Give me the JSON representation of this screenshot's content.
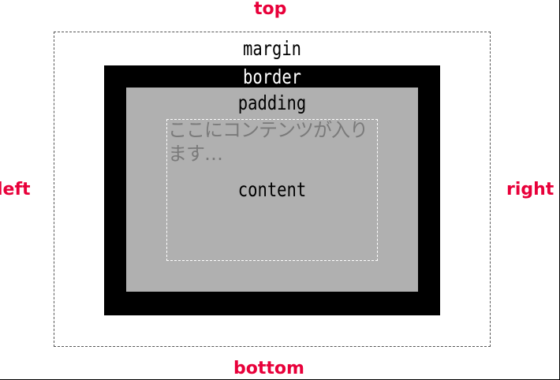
{
  "sides": {
    "top": "top",
    "bottom": "bottom",
    "left": "left",
    "right": "right"
  },
  "boxes": {
    "margin": "margin",
    "border": "border",
    "padding": "padding",
    "content": "content"
  },
  "content_text": "ここにコンテンツが入ります…",
  "colors": {
    "side_label": "#e8003a",
    "border_fill": "#000000",
    "padding_fill": "#b0b0b0",
    "content_text": "#7a7a7a"
  }
}
